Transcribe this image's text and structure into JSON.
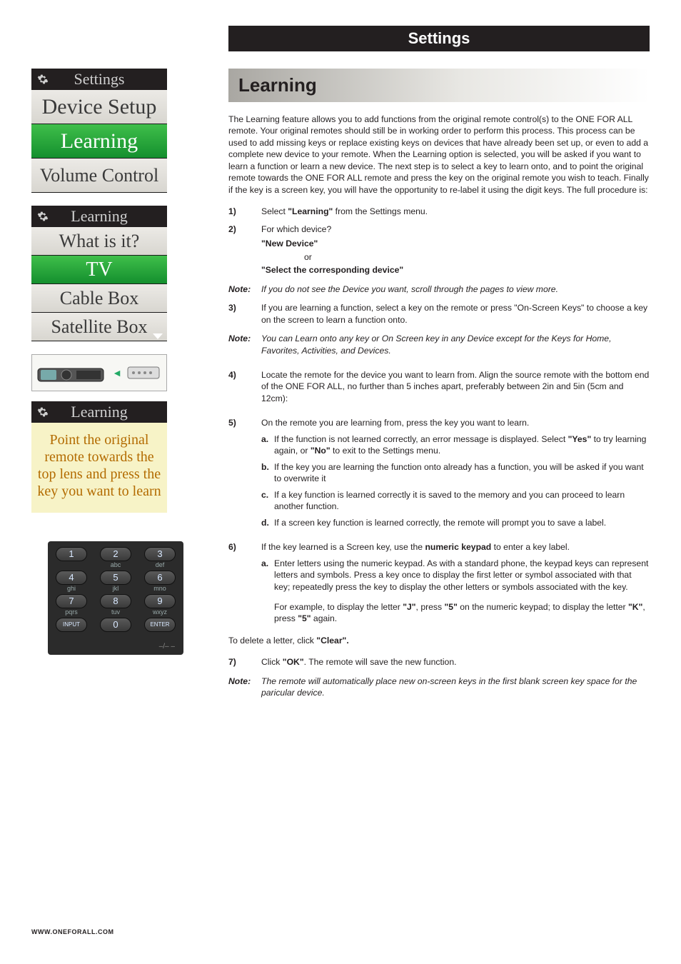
{
  "title_bar": "Settings",
  "section_header": "Learning",
  "intro": "The Learning feature allows you to add functions from the original remote control(s) to the ONE FOR ALL remote. Your original remotes should still be in working order to perform this process. This process can be used to add missing keys or replace existing keys on devices that have already been set up, or even to add a complete new device to your remote. When the Learning option is selected, you will be asked if you want to learn a function or learn a new device. The next step is to select a key to learn onto, and to point the original remote towards the ONE FOR ALL remote and press the key on the original remote you wish to teach. Finally if the key is a screen key, you will have the opportunity to re-label it using the digit keys. The full procedure is:",
  "panels": {
    "settings": {
      "header": "Settings",
      "rows": [
        "Device Setup",
        "Learning",
        "Volume Control"
      ],
      "selected_index": 1
    },
    "learning": {
      "header": "Learning",
      "rows": [
        "What is it?",
        "TV",
        "Cable Box",
        "Satellite Box"
      ],
      "selected_index": 1
    },
    "learning2": {
      "header": "Learning",
      "note": "Point the original remote towards the top lens and press the key you want to learn"
    }
  },
  "keypad": {
    "keys": [
      {
        "main": "1",
        "sub": ""
      },
      {
        "main": "2",
        "sub": "abc"
      },
      {
        "main": "3",
        "sub": "def"
      },
      {
        "main": "4",
        "sub": "ghi"
      },
      {
        "main": "5",
        "sub": "jkl"
      },
      {
        "main": "6",
        "sub": "mno"
      },
      {
        "main": "7",
        "sub": "pqrs"
      },
      {
        "main": "8",
        "sub": "tuv"
      },
      {
        "main": "9",
        "sub": "wxyz"
      },
      {
        "main": "INPUT",
        "sub": ""
      },
      {
        "main": "0",
        "sub": ""
      },
      {
        "main": "ENTER",
        "sub": ""
      }
    ],
    "footer": "–/– –"
  },
  "steps": {
    "s1": {
      "num": "1)",
      "pre": "Select ",
      "bold": "\"Learning\"",
      "post": " from the Settings menu."
    },
    "s2": {
      "num": "2)",
      "text": "For which device?"
    },
    "choice": {
      "opt1": "\"New Device\"",
      "or": "or",
      "opt2": "\"Select the corresponding device\""
    },
    "note1": {
      "label": "Note:",
      "text": "If you do not see the Device you want, scroll through the pages to view more."
    },
    "s3": {
      "num": "3)",
      "text": "If you are learning a function, select a key on the remote or press \"On-Screen Keys\" to choose a key on the screen to learn a function onto."
    },
    "note2": {
      "label": "Note:",
      "text": "You can Learn onto any key or On Screen key in any Device except for the Keys for Home, Favorites, Activities, and Devices."
    },
    "s4": {
      "num": "4)",
      "text": "Locate the remote for the device you want to learn from. Align the source remote with the bottom end of the ONE FOR ALL, no further than 5 inches apart, preferably between 2in and 5in (5cm and 12cm):"
    },
    "s5": {
      "num": "5)",
      "text": "On the remote you are learning from, press the key you want to learn."
    },
    "s5a": {
      "label": "a.",
      "pre": "If the function is not learned correctly, an error message is displayed. Select ",
      "b1": "\"Yes\"",
      "mid": " to try learning again, or ",
      "b2": "\"No\"",
      "post": " to exit to the Settings menu."
    },
    "s5b": {
      "label": "b.",
      "text": "If the key you are learning the function onto already has a function, you will be asked if you want to overwrite it"
    },
    "s5c": {
      "label": "c.",
      "text": "If a key function is learned correctly it is saved to the memory and you can proceed to learn another function."
    },
    "s5d": {
      "label": "d.",
      "text": "If a screen key function is learned correctly, the remote will prompt you to save a label."
    },
    "s6": {
      "num": "6)",
      "pre": "If the key learned is a Screen key, use the ",
      "bold": "numeric keypad",
      "post": " to enter a key label."
    },
    "s6a": {
      "label": "a.",
      "text": "Enter letters using the numeric keypad. As with a standard phone, the keypad keys can represent letters and symbols. Press a key once to display the first letter or symbol associated with that key; repeatedly press the key to display the other letters or symbols associated with the key."
    },
    "s6ex": {
      "pre": "For example, to display the letter ",
      "b1": "\"J\"",
      "mid1": ", press ",
      "b2": "\"5\"",
      "mid2": " on the numeric keypad; to display the letter ",
      "b3": "\"K\"",
      "mid3": ", press ",
      "b4": "\"5\"",
      "post": " again."
    },
    "delete": {
      "pre": "To delete a letter, click ",
      "bold": "\"Clear\"."
    },
    "s7": {
      "num": "7)",
      "pre": "Click ",
      "bold": "\"OK\"",
      "post": ". The remote will save the new function."
    },
    "note3": {
      "label": "Note:",
      "text": "The remote will automatically place new on-screen keys in the first blank screen key space for the paricular device."
    }
  },
  "footer_url": "WWW.ONEFORALL.COM"
}
